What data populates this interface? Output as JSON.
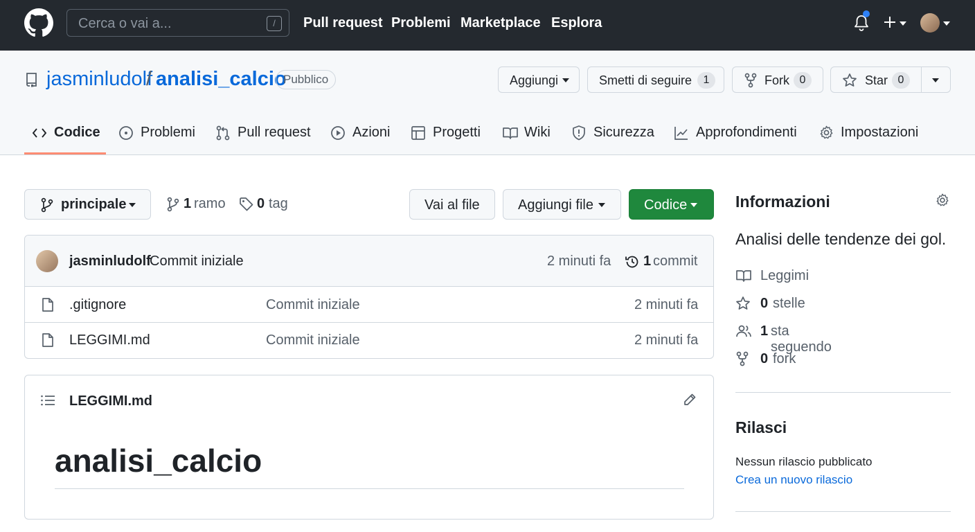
{
  "header": {
    "search_placeholder": "Cerca o vai a...",
    "search_shortcut": "/",
    "nav": [
      "Pull request",
      "Problemi",
      "Marketplace",
      "Esplora"
    ],
    "icons": [
      "github-logo-icon",
      "bell-icon",
      "plus-icon",
      "avatar"
    ]
  },
  "repo": {
    "owner": "jasminludolf",
    "separator": "/",
    "name": "analisi_calcio",
    "visibility": "Pubblico",
    "buttons": {
      "add": "Aggiungi",
      "unwatch": "Smetti di seguire",
      "unwatch_count": "1",
      "fork": "Fork",
      "fork_count": "0",
      "star": "Star",
      "star_count": "0"
    }
  },
  "tabs": [
    {
      "label": "Codice",
      "icon": "code-icon",
      "selected": true
    },
    {
      "label": "Problemi",
      "icon": "issue-icon"
    },
    {
      "label": "Pull request",
      "icon": "pull-request-icon"
    },
    {
      "label": "Azioni",
      "icon": "play-icon"
    },
    {
      "label": "Progetti",
      "icon": "table-icon"
    },
    {
      "label": "Wiki",
      "icon": "book-icon"
    },
    {
      "label": "Sicurezza",
      "icon": "shield-icon"
    },
    {
      "label": "Approfondimenti",
      "icon": "graph-icon"
    },
    {
      "label": "Impostazioni",
      "icon": "gear-icon"
    }
  ],
  "branch": {
    "name": "principale",
    "branches_count": "1",
    "branches_label": "ramo",
    "tags_count": "0",
    "tags_label": "tag",
    "go_to_file": "Vai al file",
    "add_file": "Aggiungi file",
    "code": "Codice"
  },
  "latest_commit": {
    "author": "jasminludolf",
    "message": "Commit iniziale",
    "time": "2 minuti fa",
    "commits_count": "1",
    "commits_label": "commit"
  },
  "files": [
    {
      "name": ".gitignore",
      "message": "Commit iniziale",
      "time": "2 minuti fa"
    },
    {
      "name": "LEGGIMI.md",
      "message": "Commit iniziale",
      "time": "2 minuti fa"
    }
  ],
  "readme": {
    "filename": "LEGGIMI.md",
    "heading": "analisi_calcio"
  },
  "sidebar": {
    "about_title": "Informazioni",
    "description": "Analisi delle tendenze dei gol.",
    "readme_link": "Leggimi",
    "stars_count": "0",
    "stars_label": "stelle",
    "watching_count": "1",
    "watching_label": "sta seguendo",
    "forks_count": "0",
    "forks_label": "fork",
    "releases_title": "Rilasci",
    "no_releases": "Nessun rilascio pubblicato",
    "create_release": "Crea un nuovo rilascio"
  },
  "colors": {
    "header_bg": "#24292f",
    "link": "#0969da",
    "primary_button": "#1f883d",
    "selected_tab_underline": "#fd8c73"
  }
}
